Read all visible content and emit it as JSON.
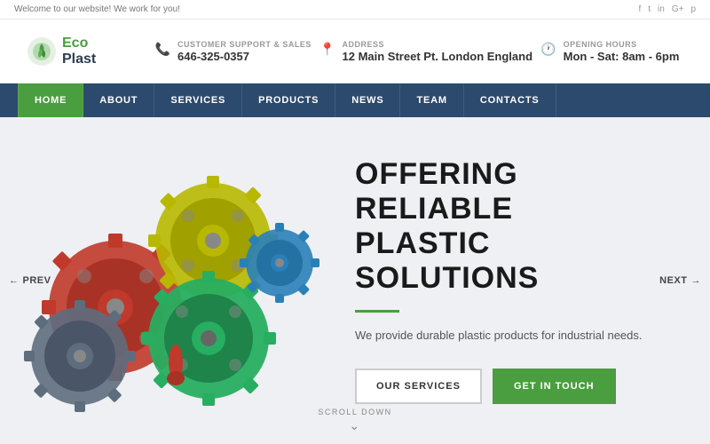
{
  "topbar": {
    "welcome": "Welcome to our website! We work for you!",
    "social": [
      "f",
      "t",
      "in",
      "G+",
      "p"
    ]
  },
  "header": {
    "logo": {
      "eco": "Eco",
      "plast": "Plast"
    },
    "contact": {
      "label": "CUSTOMER SUPPORT & SALES",
      "value": "646-325-0357"
    },
    "address": {
      "label": "ADDRESS",
      "value": "12 Main Street Pt. London England"
    },
    "hours": {
      "label": "OPENING HOURS",
      "value": "Mon - Sat: 8am - 6pm"
    }
  },
  "nav": {
    "items": [
      {
        "label": "HOME",
        "active": true
      },
      {
        "label": "ABOUT",
        "active": false
      },
      {
        "label": "SERVICES",
        "active": false
      },
      {
        "label": "PRODUCTS",
        "active": false
      },
      {
        "label": "NEWS",
        "active": false
      },
      {
        "label": "TEAM",
        "active": false
      },
      {
        "label": "CONTACTS",
        "active": false
      }
    ]
  },
  "hero": {
    "title_line1": "OFFERING RELIABLE",
    "title_line2": "PLASTIC SOLUTIONS",
    "subtitle": "We provide durable plastic products for industrial needs.",
    "btn_services": "OUR SERVICES",
    "btn_contact": "GET IN TOUCH",
    "prev": "PREV",
    "next": "NEXT",
    "scroll_down": "SCROLL DOWN"
  }
}
